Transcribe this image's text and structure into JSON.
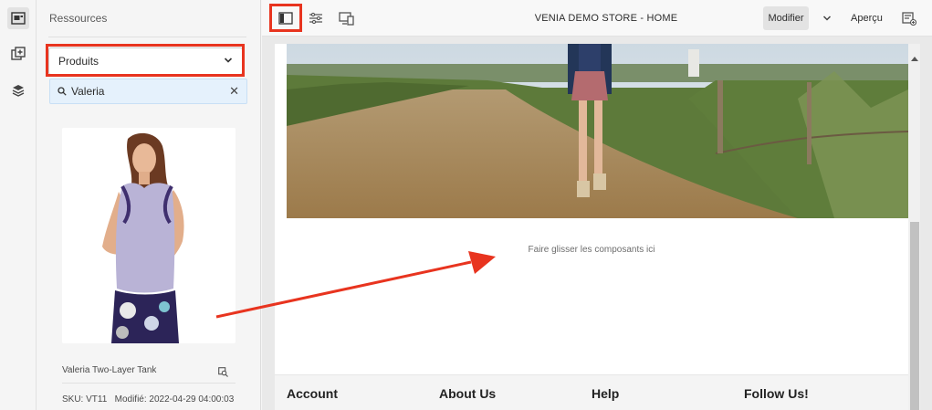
{
  "sidebar": {
    "title": "Ressources",
    "asset_type_select": {
      "value": "Produits"
    },
    "search": {
      "value": "Valeria"
    },
    "product": {
      "name": "Valeria Two-Layer Tank",
      "sku_label": "SKU: VT11",
      "modified_label": "Modifié: 2022-04-29 04:00:03"
    }
  },
  "toolbar": {
    "title": "VENIA DEMO STORE - HOME",
    "edit_label": "Modifier",
    "preview_label": "Aperçu"
  },
  "canvas": {
    "dropzone_text": "Faire glisser les composants ici",
    "footer_columns": [
      "Account",
      "About Us",
      "Help",
      "Follow Us!"
    ]
  },
  "colors": {
    "highlight": "#e8341f",
    "search_bg": "#e5f1fc"
  },
  "icons": {
    "rail": [
      "assets-icon",
      "components-icon",
      "layers-icon"
    ],
    "toolbar": [
      "side-panel-icon",
      "page-properties-icon",
      "emulator-icon",
      "chevron-down-icon",
      "annotations-icon"
    ]
  }
}
